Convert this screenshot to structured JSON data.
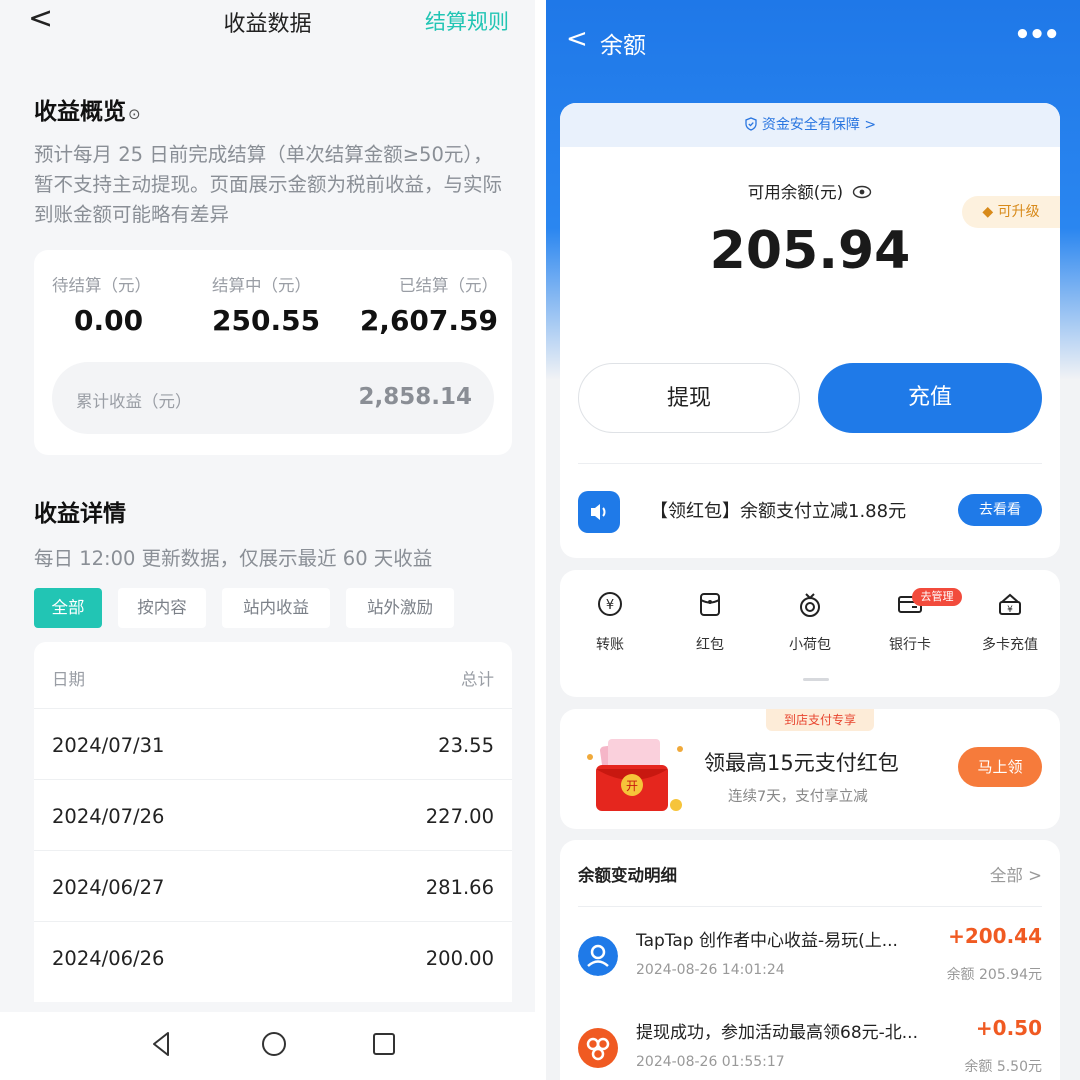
{
  "left": {
    "topbar": {
      "back": "<",
      "title": "收益数据",
      "rules": "结算规则"
    },
    "overview": {
      "title": "收益概览",
      "info": "⊙",
      "desc": "预计每月 25 日前完成结算（单次结算金额≥50元），暂不支持主动提现。页面展示金额为税前收益，与实际到账金额可能略有差异",
      "pending_label": "待结算（元）",
      "pending_value": "0.00",
      "settling_label": "结算中（元）",
      "settling_value": "250.55",
      "settled_label": "已结算（元）",
      "settled_value": "2,607.59",
      "cumulative_label": "累计收益（元）",
      "cumulative_value": "2,858.14"
    },
    "details": {
      "title": "收益详情",
      "desc": "每日 12:00 更新数据，仅展示最近 60 天收益",
      "tabs": [
        "全部",
        "按内容",
        "站内收益",
        "站外激励"
      ],
      "col_date": "日期",
      "col_total": "总计",
      "rows": [
        {
          "date": "2024/07/31",
          "total": "23.55"
        },
        {
          "date": "2024/07/26",
          "total": "227.00"
        },
        {
          "date": "2024/06/27",
          "total": "281.66"
        },
        {
          "date": "2024/06/26",
          "total": "200.00"
        }
      ]
    }
  },
  "right": {
    "header": {
      "back": "<",
      "title": "余额",
      "more": "•••"
    },
    "safety": "资金安全有保障 >",
    "available_label": "可用余额(元)",
    "balance": "205.94",
    "upgrade": "可升级",
    "withdraw": "提现",
    "topup": "充值",
    "promo_text": "【领红包】余额支付立减1.88元",
    "promo_btn": "去看看",
    "quick": [
      {
        "label": "转账",
        "icon": "transfer-icon"
      },
      {
        "label": "红包",
        "icon": "red-packet-icon"
      },
      {
        "label": "小荷包",
        "icon": "pouch-icon"
      },
      {
        "label": "银行卡",
        "icon": "bank-card-icon"
      },
      {
        "label": "多卡充值",
        "icon": "multi-card-icon"
      }
    ],
    "bank_badge": "去管理",
    "store": {
      "tag": "到店支付专享",
      "title": "领最高15元支付红包",
      "sub": "连续7天，支付享立减",
      "btn": "马上领",
      "env_char": "开"
    },
    "detail": {
      "title": "余额变动明细",
      "all": "全部 >",
      "items": [
        {
          "name": "TapTap 创作者中心收益-易玩(上...",
          "time": "2024-08-26 14:01:24",
          "amount": "+200.44",
          "balance": "余额 205.94元"
        },
        {
          "name": "提现成功，参加活动最高领68元-北...",
          "time": "2024-08-26 01:55:17",
          "amount": "+0.50",
          "balance": "余额 5.50元"
        }
      ]
    }
  },
  "colors": {
    "teal": "#22c5b4",
    "blue": "#1f7ae8",
    "orange": "#f05a22"
  }
}
